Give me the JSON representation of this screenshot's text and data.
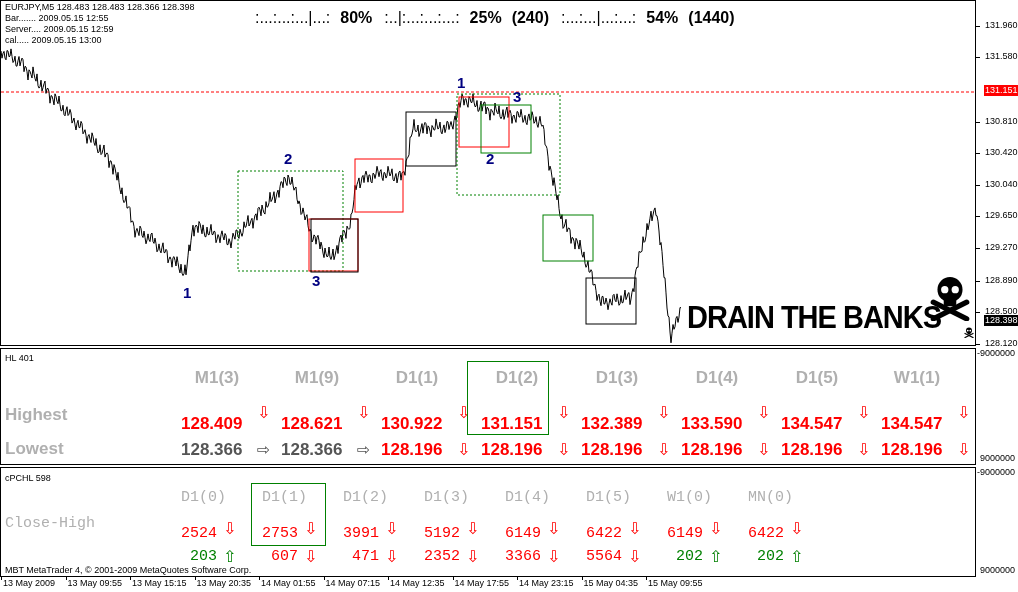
{
  "info": {
    "header": "EURJPY,M5  128.483 128.483 128.366 128.398",
    "lines": [
      "Bar....... 2009.05.15 12:55",
      "Server.... 2009.05.15 12:59",
      "cal..... 2009.05.15 13:00"
    ]
  },
  "gauges": [
    {
      "scale": ":...:...:...|...:",
      "percent": "80%"
    },
    {
      "scale": ":..|:...:...:...:",
      "percent": "25%",
      "count": "(240)"
    },
    {
      "scale": ":...:...|...:...:",
      "percent": "54%",
      "count": "(1440)"
    }
  ],
  "wave_labels": [
    "1",
    "2",
    "3",
    "1",
    "3",
    "2"
  ],
  "logo_text": "DRAIN THE BANKS",
  "price_axis": [
    {
      "text": "131.960",
      "kind": "tick"
    },
    {
      "text": "131.580",
      "kind": "tick"
    },
    {
      "text": "131.151",
      "kind": "level"
    },
    {
      "text": "130.810",
      "kind": "tick"
    },
    {
      "text": "130.420",
      "kind": "tick"
    },
    {
      "text": "130.040",
      "kind": "tick"
    },
    {
      "text": "129.650",
      "kind": "tick"
    },
    {
      "text": "129.270",
      "kind": "tick"
    },
    {
      "text": "128.890",
      "kind": "tick"
    },
    {
      "text": "128.500",
      "kind": "tick"
    },
    {
      "text": "128.398",
      "kind": "current"
    },
    {
      "text": "128.120",
      "kind": "tick"
    }
  ],
  "hl_panel": {
    "title": "HL 401",
    "axis": [
      "-9000000",
      "9000000"
    ],
    "row_labels": [
      "Highest",
      "Lowest"
    ],
    "columns": [
      {
        "header": "M1(3)",
        "selected": false,
        "high": {
          "value": "128.409",
          "color": "#ff0000",
          "arrow": "⇩"
        },
        "low": {
          "value": "128.366",
          "color": "#555555",
          "arrow": "⇨"
        }
      },
      {
        "header": "M1(9)",
        "selected": false,
        "high": {
          "value": "128.621",
          "color": "#ff0000",
          "arrow": "⇩"
        },
        "low": {
          "value": "128.366",
          "color": "#555555",
          "arrow": "⇨"
        }
      },
      {
        "header": "D1(1)",
        "selected": false,
        "high": {
          "value": "130.922",
          "color": "#ff0000",
          "arrow": "⇩"
        },
        "low": {
          "value": "128.196",
          "color": "#ff0000",
          "arrow": "⇩"
        }
      },
      {
        "header": "D1(2)",
        "selected": true,
        "high": {
          "value": "131.151",
          "color": "#ff0000",
          "arrow": "⇩"
        },
        "low": {
          "value": "128.196",
          "color": "#ff0000",
          "arrow": "⇩"
        }
      },
      {
        "header": "D1(3)",
        "selected": false,
        "high": {
          "value": "132.389",
          "color": "#ff0000",
          "arrow": "⇩"
        },
        "low": {
          "value": "128.196",
          "color": "#ff0000",
          "arrow": "⇩"
        }
      },
      {
        "header": "D1(4)",
        "selected": false,
        "high": {
          "value": "133.590",
          "color": "#ff0000",
          "arrow": "⇩"
        },
        "low": {
          "value": "128.196",
          "color": "#ff0000",
          "arrow": "⇩"
        }
      },
      {
        "header": "D1(5)",
        "selected": false,
        "high": {
          "value": "134.547",
          "color": "#ff0000",
          "arrow": "⇩"
        },
        "low": {
          "value": "128.196",
          "color": "#ff0000",
          "arrow": "⇩"
        }
      },
      {
        "header": "W1(1)",
        "selected": false,
        "high": {
          "value": "134.547",
          "color": "#ff0000",
          "arrow": "⇩"
        },
        "low": {
          "value": "128.196",
          "color": "#ff0000",
          "arrow": "⇩"
        }
      }
    ]
  },
  "pchl_panel": {
    "title": "cPCHL 598",
    "axis": [
      "-9000000",
      "9000000"
    ],
    "row_labels": [
      "Close-High"
    ],
    "columns": [
      {
        "header": "D1(0)",
        "selected": false,
        "high": {
          "value": "2524",
          "color": "#ff0000",
          "arrow": "⇩"
        },
        "low": {
          "value": "203",
          "color": "#008000",
          "arrow": "⇧"
        }
      },
      {
        "header": "D1(1)",
        "selected": true,
        "high": {
          "value": "2753",
          "color": "#ff0000",
          "arrow": "⇩"
        },
        "low": {
          "value": "607",
          "color": "#ff0000",
          "arrow": "⇩"
        }
      },
      {
        "header": "D1(2)",
        "selected": false,
        "high": {
          "value": "3991",
          "color": "#ff0000",
          "arrow": "⇩"
        },
        "low": {
          "value": "471",
          "color": "#ff0000",
          "arrow": "⇩"
        }
      },
      {
        "header": "D1(3)",
        "selected": false,
        "high": {
          "value": "5192",
          "color": "#ff0000",
          "arrow": "⇩"
        },
        "low": {
          "value": "2352",
          "color": "#ff0000",
          "arrow": "⇩"
        }
      },
      {
        "header": "D1(4)",
        "selected": false,
        "high": {
          "value": "6149",
          "color": "#ff0000",
          "arrow": "⇩"
        },
        "low": {
          "value": "3366",
          "color": "#ff0000",
          "arrow": "⇩"
        }
      },
      {
        "header": "D1(5)",
        "selected": false,
        "high": {
          "value": "6422",
          "color": "#ff0000",
          "arrow": "⇩"
        },
        "low": {
          "value": "5564",
          "color": "#ff0000",
          "arrow": "⇩"
        }
      },
      {
        "header": "W1(0)",
        "selected": false,
        "high": {
          "value": "6149",
          "color": "#ff0000",
          "arrow": "⇩"
        },
        "low": {
          "value": "202",
          "color": "#008000",
          "arrow": "⇧"
        }
      },
      {
        "header": "MN(0)",
        "selected": false,
        "high": {
          "value": "6422",
          "color": "#ff0000",
          "arrow": "⇩"
        },
        "low": {
          "value": "202",
          "color": "#008000",
          "arrow": "⇧"
        }
      }
    ]
  },
  "copyright": "MBT MetaTrader 4, © 2001-2009 MetaQuotes Software Corp.",
  "time_axis": [
    "13 May 2009",
    "13 May 09:55",
    "13 May 15:15",
    "13 May 20:35",
    "14 May 01:55",
    "14 May 07:15",
    "14 May 12:35",
    "14 May 17:55",
    "14 May 23:15",
    "15 May 04:35",
    "15 May 09:55"
  ]
}
